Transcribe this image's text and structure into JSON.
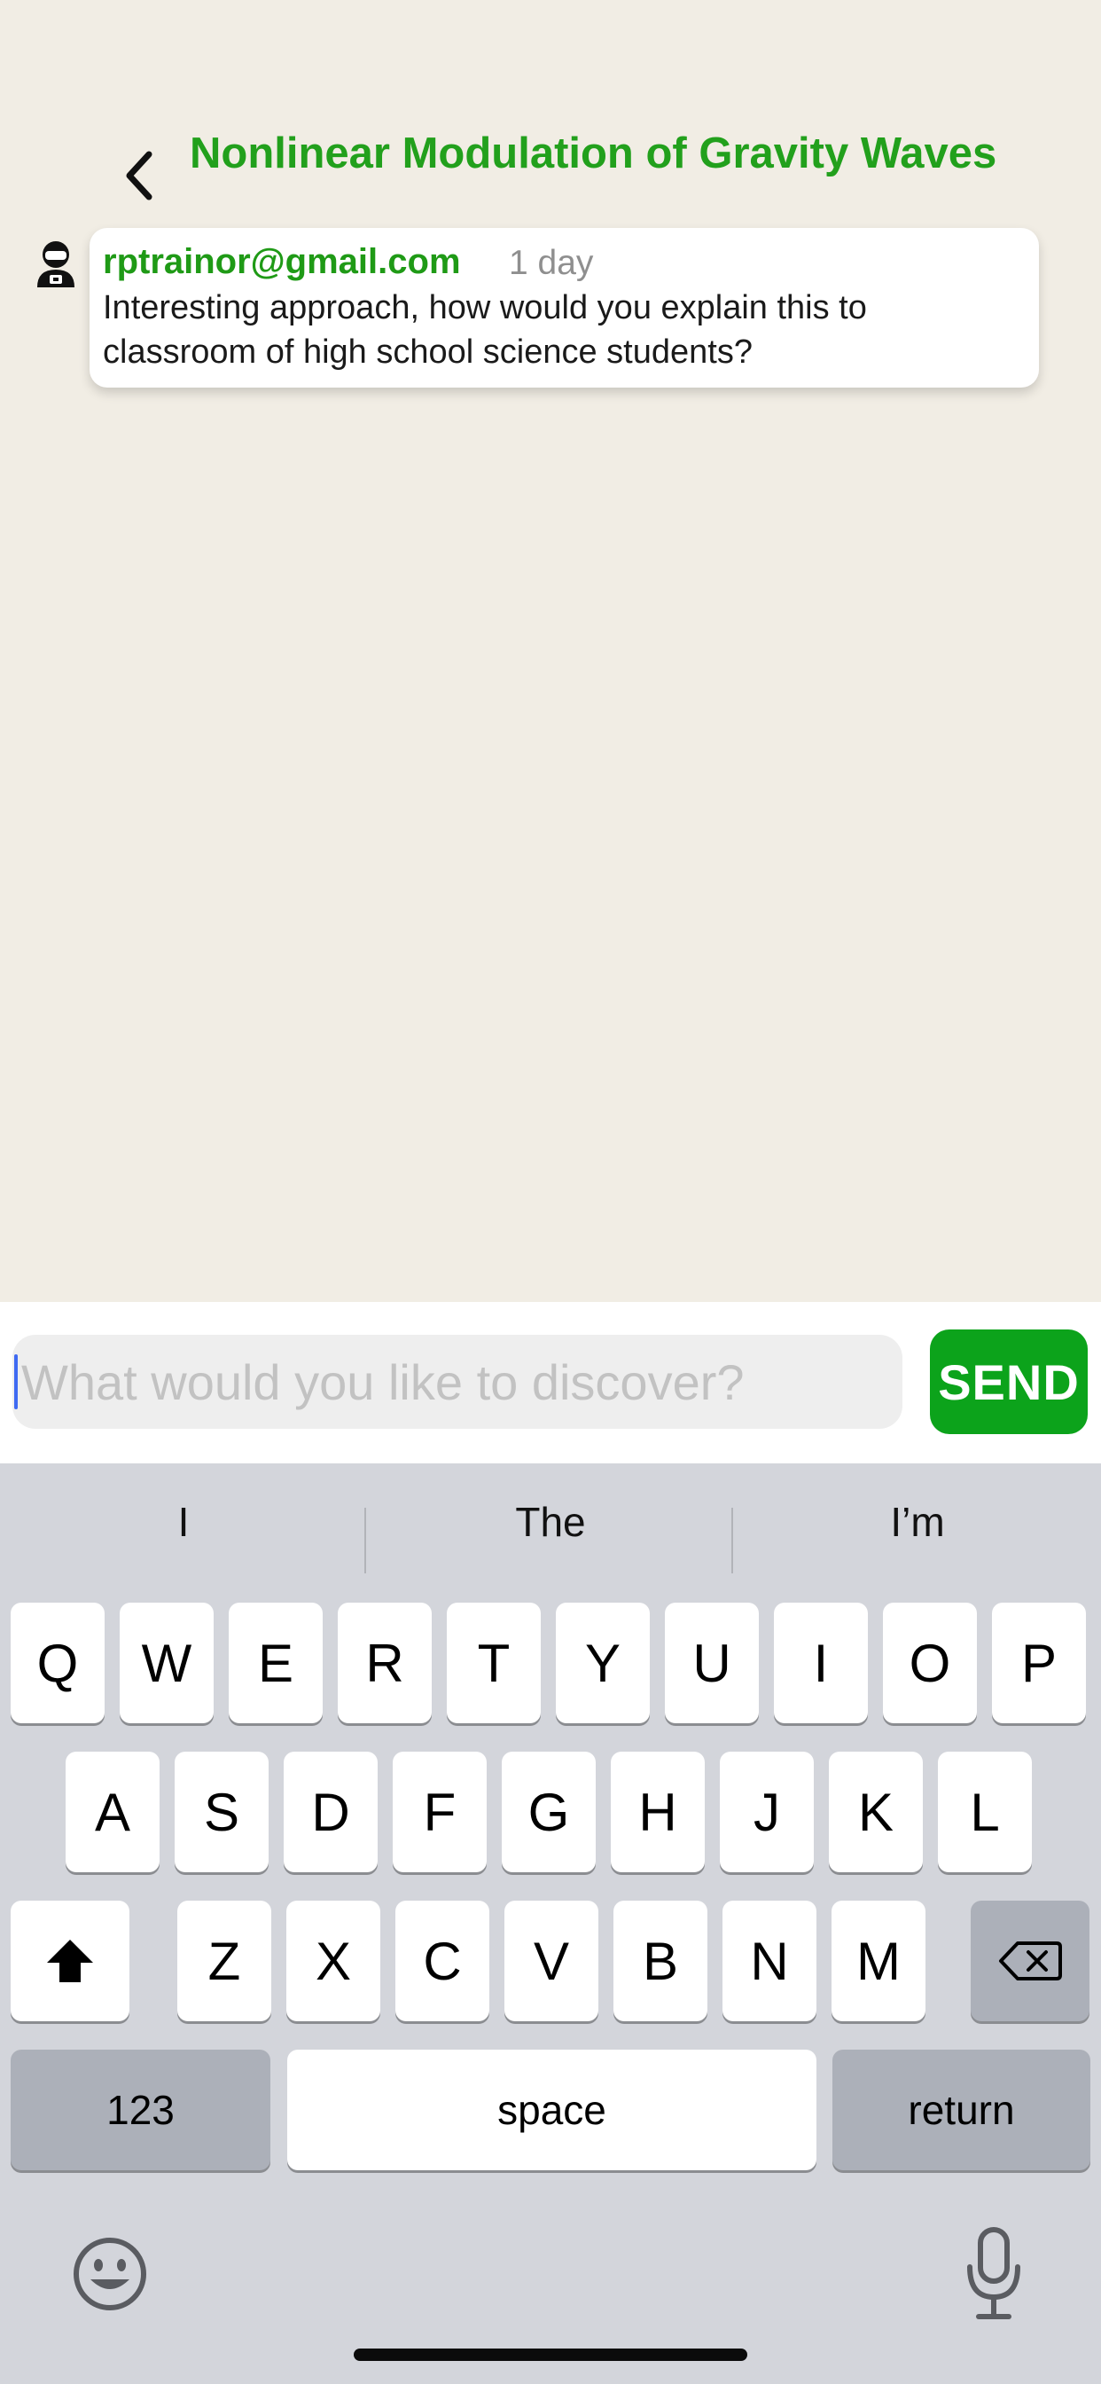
{
  "header": {
    "title": "Nonlinear Modulation of Gravity Waves",
    "back_icon": "chevron-left-icon"
  },
  "comment": {
    "author": "rptrainor@gmail.com",
    "time": "1 day",
    "text": "Interesting approach, how would you explain this to classroom of high school science students?"
  },
  "composer": {
    "placeholder": "What would you like to discover?",
    "value": "",
    "send_label": "SEND"
  },
  "keyboard": {
    "suggestions": [
      "I",
      "The",
      "I’m"
    ],
    "row1": [
      "Q",
      "W",
      "E",
      "R",
      "T",
      "Y",
      "U",
      "I",
      "O",
      "P"
    ],
    "row2": [
      "A",
      "S",
      "D",
      "F",
      "G",
      "H",
      "J",
      "K",
      "L"
    ],
    "row3": [
      "Z",
      "X",
      "C",
      "V",
      "B",
      "N",
      "M"
    ],
    "numbers_label": "123",
    "space_label": "space",
    "return_label": "return",
    "icons": [
      "shift-icon",
      "backspace-icon",
      "emoji-icon",
      "microphone-icon"
    ]
  },
  "colors": {
    "background": "#f1ede4",
    "accent_green": "#22a01c",
    "send_green": "#0ca31b",
    "keyboard_bg": "#d3d5db"
  }
}
